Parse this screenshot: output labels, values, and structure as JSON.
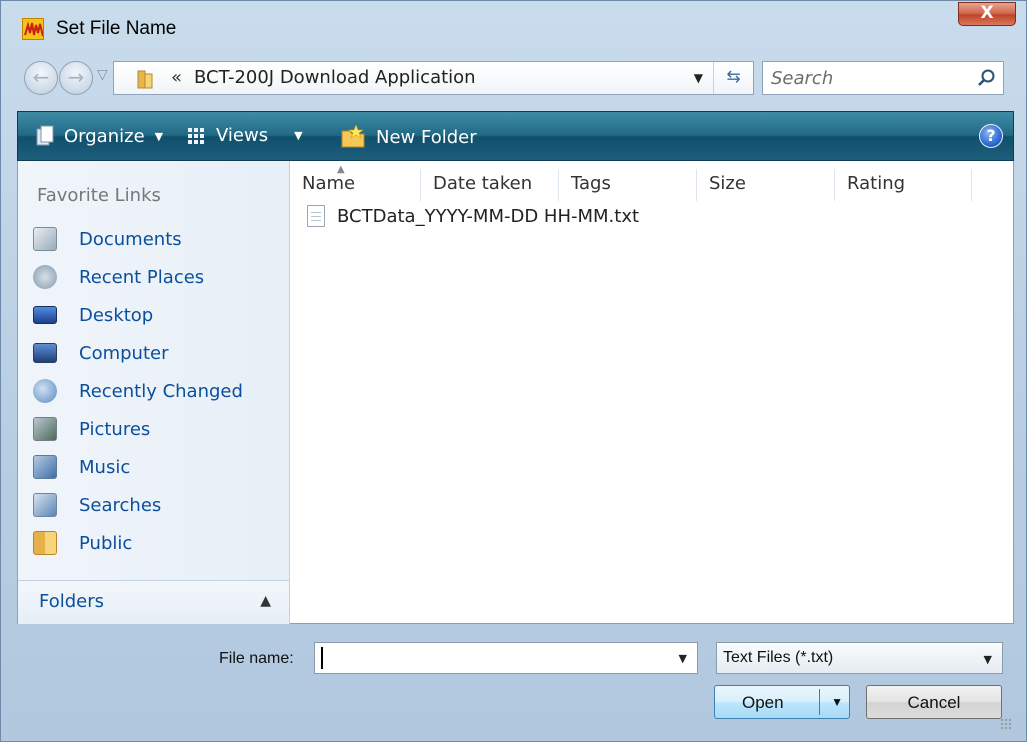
{
  "window": {
    "title": "Set File Name",
    "close_label": "X"
  },
  "address": {
    "crumb_separator": "«",
    "path": "BCT-200J Download Application",
    "search_placeholder": "Search"
  },
  "toolbar": {
    "organize_label": "Organize",
    "views_label": "Views",
    "new_folder_label": "New Folder",
    "help_label": "?"
  },
  "sidebar": {
    "favorite_links_title": "Favorite Links",
    "items": [
      {
        "label": "Documents",
        "icon": "documents-icon"
      },
      {
        "label": "Recent Places",
        "icon": "recent-places-icon"
      },
      {
        "label": "Desktop",
        "icon": "desktop-icon"
      },
      {
        "label": "Computer",
        "icon": "computer-icon"
      },
      {
        "label": "Recently Changed",
        "icon": "recently-changed-icon"
      },
      {
        "label": "Pictures",
        "icon": "pictures-icon"
      },
      {
        "label": "Music",
        "icon": "music-icon"
      },
      {
        "label": "Searches",
        "icon": "searches-icon"
      },
      {
        "label": "Public",
        "icon": "public-folder-icon"
      }
    ],
    "folders_label": "Folders"
  },
  "file_list": {
    "columns": [
      "Name",
      "Date taken",
      "Tags",
      "Size",
      "Rating"
    ],
    "files": [
      {
        "name": "BCTData_YYYY-MM-DD HH-MM.txt"
      }
    ]
  },
  "bottom": {
    "file_name_label": "File name:",
    "file_name_value": "",
    "file_type_value": "Text Files (*.txt)",
    "open_label": "Open",
    "cancel_label": "Cancel"
  }
}
